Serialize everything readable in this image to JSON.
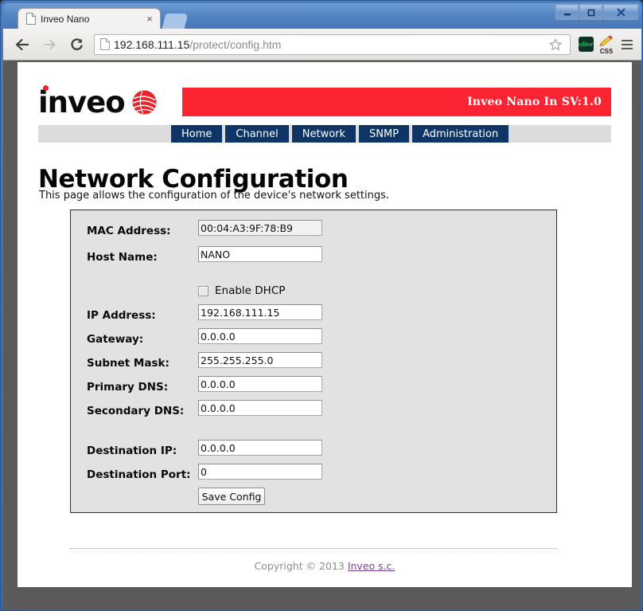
{
  "browser": {
    "tab": {
      "title": "Inveo Nano",
      "favicon": "page-icon",
      "close": "×"
    },
    "window_controls": {
      "minimize": "minimize-icon",
      "maximize": "maximize-icon",
      "close": "close-icon"
    },
    "toolbar": {
      "back": "back-arrow-icon",
      "forward": "forward-arrow-icon",
      "reload": "reload-icon",
      "url_host": "192.168.111.15",
      "url_path": "/protect/config.htm",
      "bookmark": "star-icon",
      "extensions": [
        {
          "name": "editor-extension-icon",
          "label": "editor"
        },
        {
          "name": "css-extension-icon",
          "label": "CSS"
        }
      ],
      "menu": "hamburger-menu-icon"
    }
  },
  "site": {
    "logo_text": "inveo",
    "banner_text": "Inveo Nano In SV:1.0",
    "nav": [
      {
        "label": "Home"
      },
      {
        "label": "Channel"
      },
      {
        "label": "Network"
      },
      {
        "label": "SNMP"
      },
      {
        "label": "Administration"
      }
    ],
    "page_title": "Network Configuration",
    "page_description": "This page allows the configuration of the device's network settings.",
    "form": {
      "fields": [
        {
          "label": "MAC Address:",
          "value": "00:04:A3:9F:78:B9",
          "name": "mac-address"
        },
        {
          "label": "Host Name:",
          "value": "NANO",
          "name": "host-name"
        },
        {
          "label": "IP Address:",
          "value": "192.168.111.15",
          "name": "ip-address"
        },
        {
          "label": "Gateway:",
          "value": "0.0.0.0",
          "name": "gateway"
        },
        {
          "label": "Subnet Mask:",
          "value": "255.255.255.0",
          "name": "subnet-mask"
        },
        {
          "label": "Primary DNS:",
          "value": "0.0.0.0",
          "name": "primary-dns"
        },
        {
          "label": "Secondary DNS:",
          "value": "0.0.0.0",
          "name": "secondary-dns"
        },
        {
          "label": "Destination IP:",
          "value": "0.0.0.0",
          "name": "destination-ip"
        },
        {
          "label": "Destination Port:",
          "value": "0",
          "name": "destination-port"
        }
      ],
      "dhcp_label": "Enable DHCP",
      "dhcp_checked": false,
      "save_label": "Save Config"
    },
    "footer": {
      "copyright": "Copyright © 2013 ",
      "link": "Inveo s.c."
    },
    "colors": {
      "banner_red": "#fc2332",
      "nav_blue": "#0f3566",
      "panel_gray": "#e2e2e2",
      "navbar_gray": "#dcdcdc"
    }
  }
}
